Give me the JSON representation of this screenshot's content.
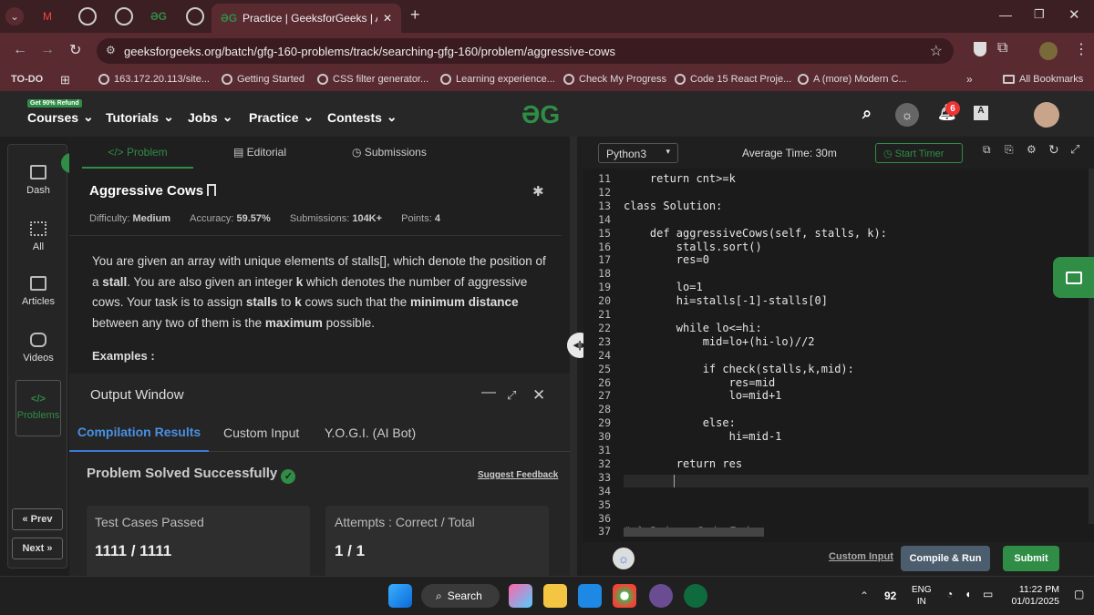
{
  "browser": {
    "active_tab_title": "Practice | GeeksforGeeks | A co",
    "url": "geeksforgeeks.org/batch/gfg-160-problems/track/searching-gfg-160/problem/aggressive-cows",
    "bookmarks": [
      "TO-DO",
      "163.172.20.113/site...",
      "Getting Started",
      "CSS filter generator...",
      "Learning experience...",
      "Check My Progress",
      "Code 15 React Proje...",
      "A (more) Modern C..."
    ],
    "all_bookmarks": "All Bookmarks",
    "more": "»"
  },
  "gfg_nav": {
    "promo": "Get 90% Refund",
    "items": [
      "Courses",
      "Tutorials",
      "Jobs",
      "Practice",
      "Contests"
    ],
    "notifications": "6"
  },
  "left_nav": {
    "items": [
      "Dash",
      "All",
      "Articles",
      "Videos",
      "Problems"
    ],
    "prev": "« Prev",
    "next": "Next »"
  },
  "problem": {
    "tabs": [
      "</> Problem",
      "Editorial",
      "Submissions"
    ],
    "title": "Aggressive Cows",
    "difficulty_label": "Difficulty:",
    "difficulty": "Medium",
    "accuracy_label": "Accuracy:",
    "accuracy": "59.57%",
    "submissions_label": "Submissions:",
    "submissions": "104K+",
    "points_label": "Points:",
    "points": "4",
    "desc_1": "You are given an array with unique elements of stalls[], which denote the position of a",
    "desc_stall": "stall",
    "desc_2": ". You are also given an integer",
    "desc_k": "k",
    "desc_3": "which denotes the number of aggressive cows. Your task is to assign",
    "desc_stalls": "stalls",
    "desc_4": "to",
    "desc_k2": "k",
    "desc_5": "cows such that the",
    "desc_min": "minimum distance",
    "desc_6": "between any two of them is the",
    "desc_max": "maximum",
    "desc_7": "possible.",
    "examples": "Examples :"
  },
  "output": {
    "title": "Output Window",
    "tabs": [
      "Compilation Results",
      "Custom Input",
      "Y.O.G.I. (AI Bot)"
    ],
    "status": "Problem Solved Successfully",
    "feedback": "Suggest Feedback",
    "card1_label": "Test Cases Passed",
    "card1_value": "1111 / 1111",
    "card2_label": "Attempts : Correct / Total",
    "card2_value": "1 / 1"
  },
  "editor": {
    "language": "Python3",
    "avg_time": "Average Time: 30m",
    "start_timer": "Start Timer",
    "lines": [
      {
        "n": "11",
        "code": "    return cnt>=k"
      },
      {
        "n": "12",
        "code": ""
      },
      {
        "n": "13",
        "code": "class Solution:"
      },
      {
        "n": "14",
        "code": ""
      },
      {
        "n": "15",
        "code": "    def aggressiveCows(self, stalls, k):"
      },
      {
        "n": "16",
        "code": "        stalls.sort()"
      },
      {
        "n": "17",
        "code": "        res=0"
      },
      {
        "n": "18",
        "code": ""
      },
      {
        "n": "19",
        "code": "        lo=1"
      },
      {
        "n": "20",
        "code": "        hi=stalls[-1]-stalls[0]"
      },
      {
        "n": "21",
        "code": ""
      },
      {
        "n": "22",
        "code": "        while lo<=hi:"
      },
      {
        "n": "23",
        "code": "            mid=lo+(hi-lo)//2"
      },
      {
        "n": "24",
        "code": ""
      },
      {
        "n": "25",
        "code": "            if check(stalls,k,mid):"
      },
      {
        "n": "26",
        "code": "                res=mid"
      },
      {
        "n": "27",
        "code": "                lo=mid+1"
      },
      {
        "n": "28",
        "code": ""
      },
      {
        "n": "29",
        "code": "            else:"
      },
      {
        "n": "30",
        "code": "                hi=mid-1"
      },
      {
        "n": "31",
        "code": ""
      },
      {
        "n": "32",
        "code": "        return res"
      },
      {
        "n": "33",
        "code": ""
      },
      {
        "n": "34",
        "code": ""
      },
      {
        "n": "35",
        "code": ""
      },
      {
        "n": "36",
        "code": ""
      },
      {
        "n": "37",
        "code": "# } Driver Code Ends"
      }
    ],
    "custom_input": "Custom Input",
    "compile_run": "Compile & Run",
    "submit": "Submit"
  },
  "taskbar": {
    "search": "Search",
    "temp": "92",
    "lang_top": "ENG",
    "lang_bottom": "IN",
    "time": "11:22 PM",
    "date": "01/01/2025"
  },
  "colors": {
    "accent_green": "#2f8d46",
    "tab_bar": "#3c1f23"
  }
}
